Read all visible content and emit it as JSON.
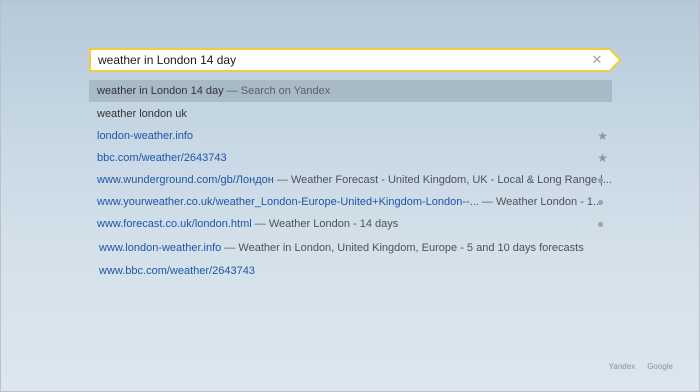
{
  "omnibox": {
    "value": "weather in London 14 day"
  },
  "suggestions": [
    {
      "text": "weather in London 14 day",
      "sep": " — ",
      "desc": "Search on Yandex"
    },
    {
      "text": "weather london uk"
    },
    {
      "url": "london-weather.info",
      "marker": "star"
    },
    {
      "url": "bbc.com/weather/2643743",
      "marker": "star"
    },
    {
      "url": "www.wunderground.com/gb/Лондон",
      "sep": " — ",
      "desc": "Weather Forecast - United Kingdom, UK - Local & Long Range |...",
      "marker": "dot"
    },
    {
      "url": "www.yourweather.co.uk/weather_London-Europe-United+Kingdom-London--...",
      "sep": " — ",
      "desc": "Weather London - 1...",
      "marker": "dot"
    },
    {
      "url": "www.forecast.co.uk/london.html",
      "sep": " — ",
      "desc": "Weather London - 14 days",
      "marker": "dot"
    },
    {
      "url": "www.london-weather.info",
      "sep": " — ",
      "desc": "Weather in London, United Kingdom, Europe - 5 and 10 days forecasts"
    },
    {
      "url": "www.bbc.com/weather/2643743"
    }
  ],
  "engines": {
    "yandex": "Yandex",
    "google": "Google"
  },
  "colors": {
    "accent": "#f0cd3b",
    "link": "#1f55a8"
  },
  "icons": {
    "clear": "close-icon",
    "bookmark": "star-icon",
    "history": "dot-icon"
  }
}
